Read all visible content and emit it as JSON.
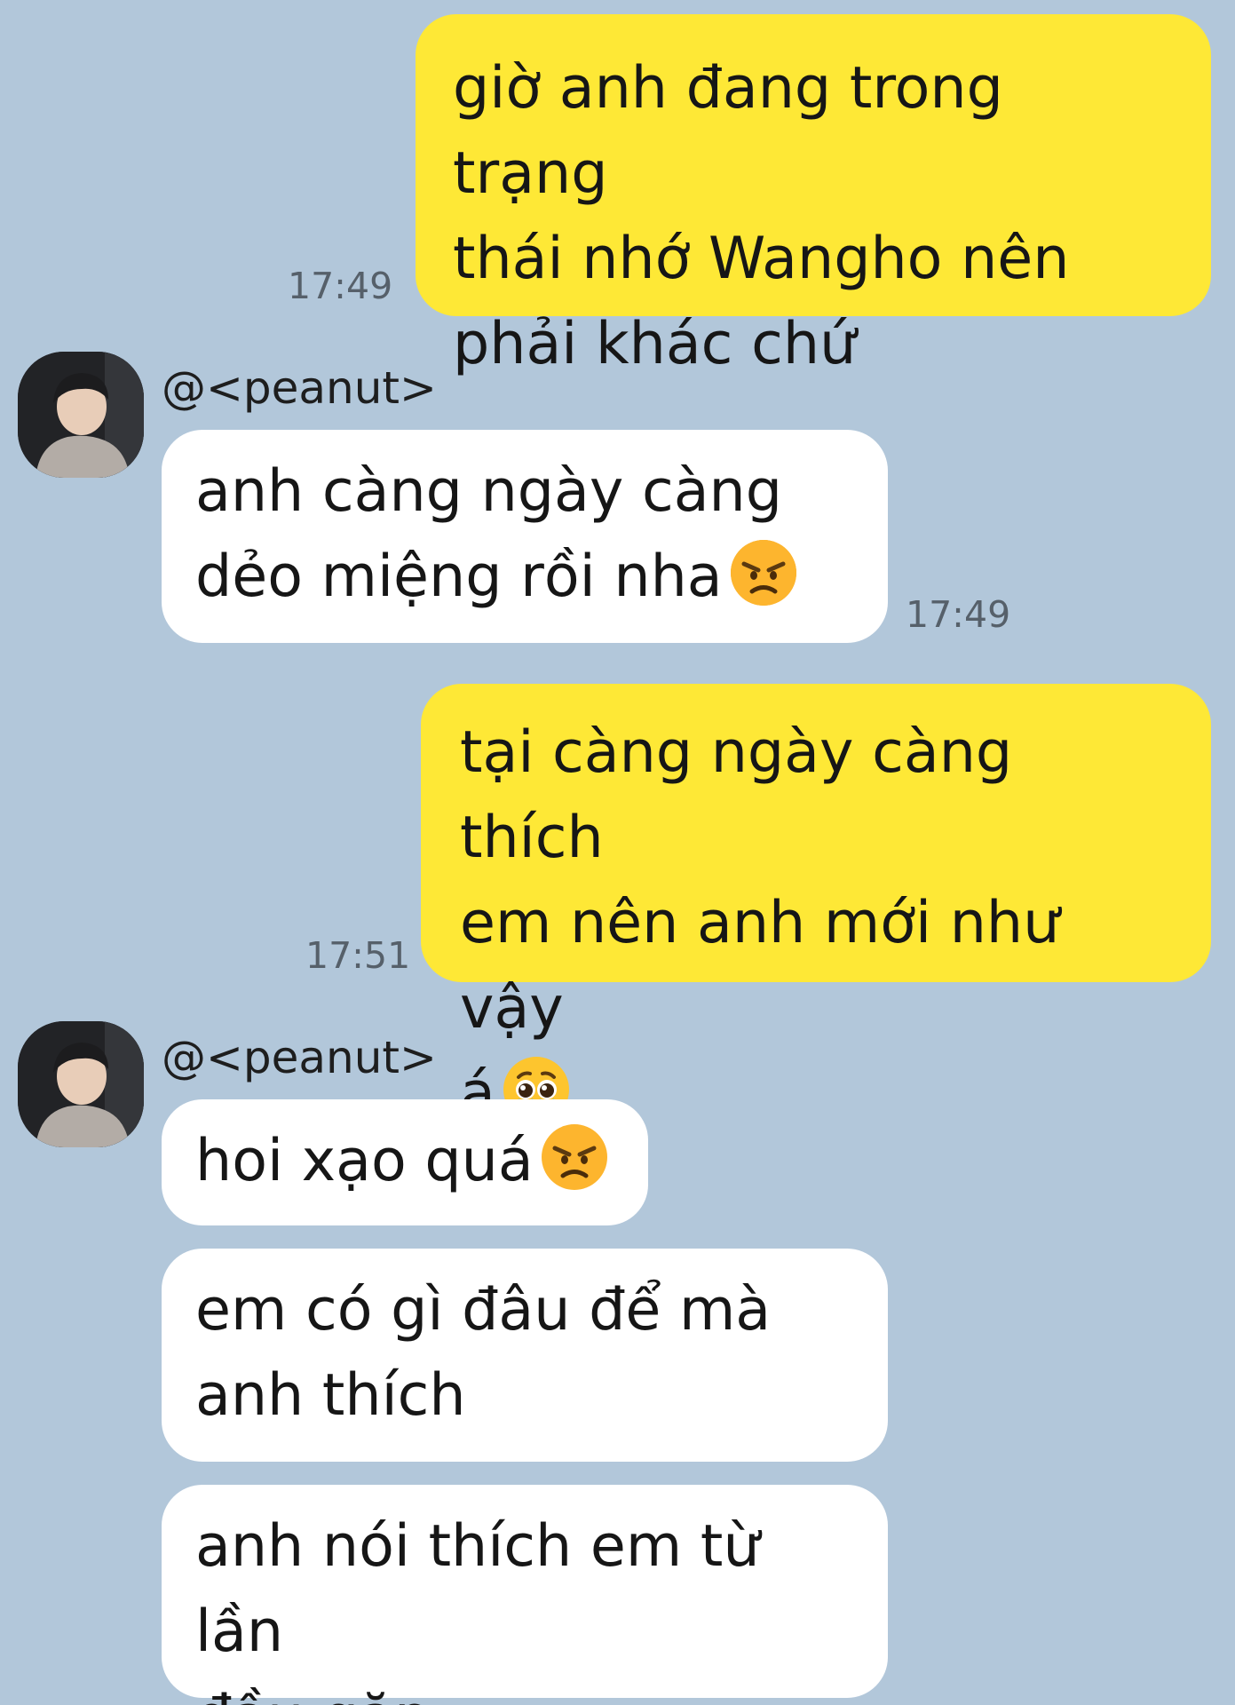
{
  "chat": {
    "contact_name": "@<peanut>",
    "colors": {
      "background": "#b2c7da",
      "outgoing_bubble": "#fee836",
      "incoming_bubble": "#ffffff"
    },
    "messages": [
      {
        "direction": "outgoing",
        "text": "giờ anh đang trong trạng\nthái nhớ Wangho nên\nphải khác chứ",
        "time": "17:49"
      },
      {
        "direction": "incoming",
        "text": "anh càng ngày càng\ndẻo miệng rồi nha",
        "emoji": "angry-face-icon",
        "time": "17:49"
      },
      {
        "direction": "outgoing",
        "text": "tại càng ngày càng thích\nem nên anh mới như vậy\ná",
        "emoji": "pleading-face-icon",
        "time": "17:51"
      },
      {
        "direction": "incoming",
        "text": "hoi xạo quá",
        "emoji": "angry-face-icon"
      },
      {
        "direction": "incoming",
        "text": "em có gì đâu để mà\nanh thích"
      },
      {
        "direction": "incoming",
        "text": "anh nói thích em từ lần\nđầu gặp"
      }
    ]
  }
}
